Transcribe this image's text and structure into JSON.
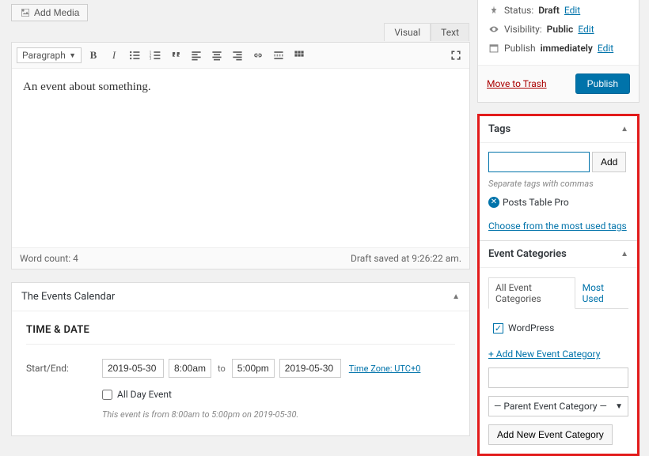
{
  "addMedia": {
    "label": "Add Media"
  },
  "editor": {
    "tabs": {
      "visual": "Visual",
      "text": "Text"
    },
    "paragraphLabel": "Paragraph",
    "content": "An event about something.",
    "wordCount": "Word count: 4",
    "saved": "Draft saved at 9:26:22 am."
  },
  "metabox": {
    "title": "The Events Calendar",
    "sectionTitle": "TIME & DATE",
    "startEndLabel": "Start/End:",
    "startDate": "2019-05-30",
    "startTime": "8:00am",
    "toLabel": "to",
    "endTime": "5:00pm",
    "endDate": "2019-05-30",
    "tzLabel": "Time Zone: UTC+0",
    "allDayLabel": "All Day Event",
    "hint": "This event is from 8:00am to 5:00pm on 2019-05-30."
  },
  "publish": {
    "statusLabel": "Status:",
    "statusValue": "Draft",
    "visibilityLabel": "Visibility:",
    "visibilityValue": "Public",
    "scheduleLabel": "Publish",
    "scheduleValue": "immediately",
    "editLabel": "Edit",
    "trashLabel": "Move to Trash",
    "publishBtn": "Publish"
  },
  "tags": {
    "title": "Tags",
    "addBtn": "Add",
    "hint": "Separate tags with commas",
    "chip": "Posts Table Pro",
    "chooseLink": "Choose from the most used tags"
  },
  "categories": {
    "title": "Event Categories",
    "tabAll": "All Event Categories",
    "tabMost": "Most Used",
    "item": "WordPress",
    "addLink": "+ Add New Event Category",
    "parentPlaceholder": "— Parent Event Category —",
    "addBtn": "Add New Event Category"
  }
}
